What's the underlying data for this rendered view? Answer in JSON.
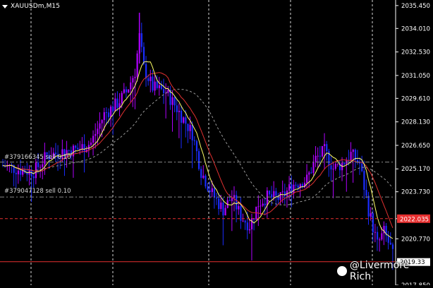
{
  "window": {
    "symbol_title": "XAUUSDm,M15"
  },
  "colors": {
    "background": "#000000",
    "bull_candle": "#b000ff",
    "bear_candle": "#1a2cff",
    "ma_fast": "#ffff66",
    "ma_mid": "#e03030",
    "ma_slow": "#9a9a9a",
    "price_line_red": "#e83030",
    "axis_text": "#ffffff",
    "grid_vertical": "#ffffff"
  },
  "orders": [
    {
      "label": "#379166345 sell 0.10",
      "price": 2025.6
    },
    {
      "label": "#379047128 sell 0.10",
      "price": 2023.4
    }
  ],
  "price_axis": {
    "labels": [
      "2035.450",
      "2034.010",
      "2032.530",
      "2031.050",
      "2029.610",
      "2028.130",
      "2026.650",
      "2025.170",
      "2023.730",
      "2022.035",
      "2020.770",
      "2019.330",
      "2017.850"
    ],
    "current_bid_badge": "2022.035",
    "ask_badge": "2019.33"
  },
  "watermark": {
    "text": "@Livermore Rich",
    "icon": "weibo-icon"
  },
  "chart_data": {
    "type": "candlestick",
    "title": "XAUUSDm,M15",
    "ylim": [
      2017.85,
      2035.8
    ],
    "moving_averages": [
      "fast",
      "mid",
      "slow"
    ],
    "horizontal_lines": [
      {
        "price": 2025.6,
        "style": "dash-dot",
        "color": "#8a8a8a"
      },
      {
        "price": 2023.4,
        "style": "dash-dot",
        "color": "#8a8a8a"
      },
      {
        "price": 2022.035,
        "style": "dashed",
        "color": "#e83030"
      },
      {
        "price": 2019.33,
        "style": "solid",
        "color": "#e83030"
      }
    ],
    "vertical_grid_count": 5
  }
}
